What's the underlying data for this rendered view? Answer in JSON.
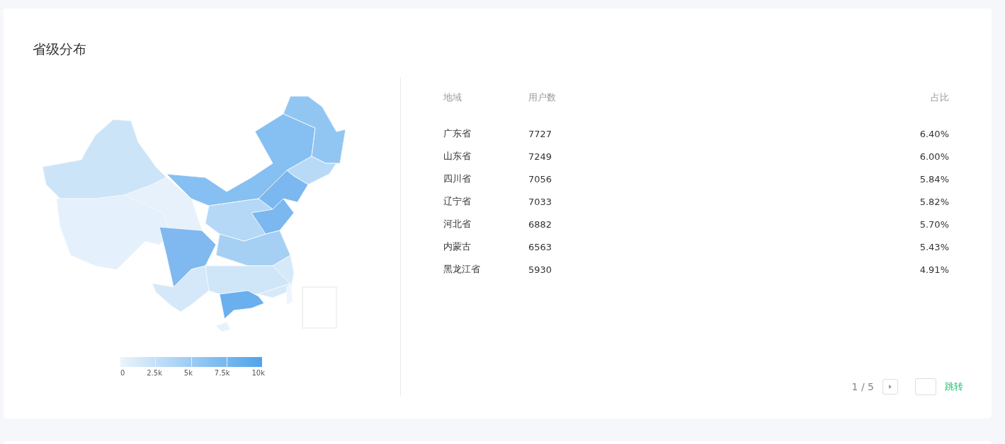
{
  "card": {
    "title": "省级分布"
  },
  "map": {
    "legend": {
      "labels": [
        "0",
        "2.5k",
        "5k",
        "7.5k",
        "10k"
      ]
    }
  },
  "table": {
    "columns": [
      "地域",
      "用户数",
      "占比"
    ],
    "rows": [
      {
        "region": "广东省",
        "users": "7727",
        "share": "6.40%"
      },
      {
        "region": "山东省",
        "users": "7249",
        "share": "6.00%"
      },
      {
        "region": "四川省",
        "users": "7056",
        "share": "5.84%"
      },
      {
        "region": "辽宁省",
        "users": "7033",
        "share": "5.82%"
      },
      {
        "region": "河北省",
        "users": "6882",
        "share": "5.70%"
      },
      {
        "region": "内蒙古",
        "users": "6563",
        "share": "5.43%"
      },
      {
        "region": "黑龙江省",
        "users": "5930",
        "share": "4.91%"
      }
    ]
  },
  "pagination": {
    "page": "1 / 5",
    "jump": "跳转"
  }
}
